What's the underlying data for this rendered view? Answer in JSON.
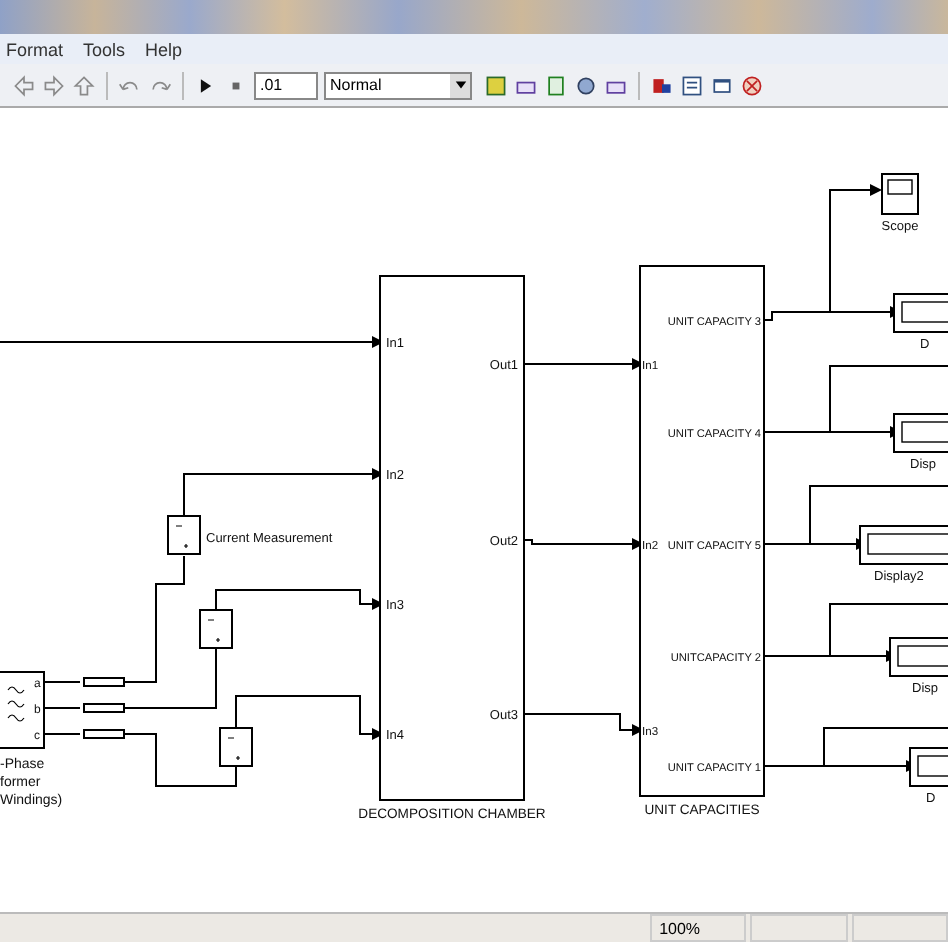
{
  "menu": [
    "Format",
    "Tools",
    "Help"
  ],
  "toolbar": {
    "stop_time": ".01",
    "sim_mode": "Normal"
  },
  "diagram": {
    "transformer": {
      "ports": [
        "a",
        "b",
        "c"
      ],
      "label_lines": [
        "-Phase",
        "former",
        "Windings)"
      ]
    },
    "measurement_label": "Current Measurement",
    "decomposition": {
      "label": "DECOMPOSITION CHAMBER",
      "inputs": [
        "In1",
        "In2",
        "In3",
        "In4"
      ],
      "outputs": [
        "Out1",
        "Out2",
        "Out3"
      ]
    },
    "unit_capacities": {
      "label": "UNIT CAPACITIES",
      "inputs": [
        "In1",
        "In2",
        "In3"
      ],
      "outputs": [
        "UNIT CAPACITY 3",
        "UNIT CAPACITY 4",
        "UNIT CAPACITY 5",
        "UNITCAPACITY 2",
        "UNIT CAPACITY 1"
      ]
    },
    "scope": {
      "label": "Scope"
    },
    "displays": [
      {
        "label": "D"
      },
      {
        "label": "Disp"
      },
      {
        "label": "Display2"
      },
      {
        "label": "Disp"
      },
      {
        "label": "D"
      }
    ]
  },
  "status_bar": {
    "zoom": "100%"
  }
}
